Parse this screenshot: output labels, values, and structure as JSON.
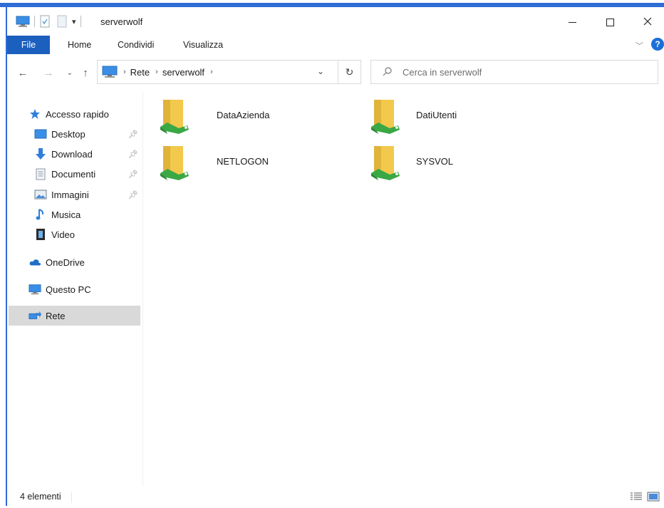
{
  "window": {
    "title": "serverwolf"
  },
  "ribbon": {
    "tabs": [
      "File",
      "Home",
      "Condividi",
      "Visualizza"
    ]
  },
  "address": {
    "crumbs": [
      "Rete",
      "serverwolf"
    ]
  },
  "search": {
    "placeholder": "Cerca in serverwolf"
  },
  "navpane": {
    "quick_access": "Accesso rapido",
    "pinned": [
      {
        "label": "Desktop",
        "icon": "desktop-icon"
      },
      {
        "label": "Download",
        "icon": "download-arrow-icon"
      },
      {
        "label": "Documenti",
        "icon": "document-icon"
      },
      {
        "label": "Immagini",
        "icon": "pictures-icon"
      }
    ],
    "other": [
      {
        "label": "Musica",
        "icon": "music-note-icon"
      },
      {
        "label": "Video",
        "icon": "film-icon"
      }
    ],
    "onedrive": "OneDrive",
    "this_pc": "Questo PC",
    "network": "Rete"
  },
  "folders": [
    {
      "name": "DataAzienda"
    },
    {
      "name": "DatiUtenti"
    },
    {
      "name": "NETLOGON"
    },
    {
      "name": "SYSVOL"
    }
  ],
  "status": {
    "count": "4 elementi"
  },
  "colors": {
    "accent": "#2e6cd6",
    "file_tab": "#1b5fbf",
    "selected": "#d9d9d9",
    "folder": "#f2c94c",
    "network_green": "#3aa845"
  }
}
